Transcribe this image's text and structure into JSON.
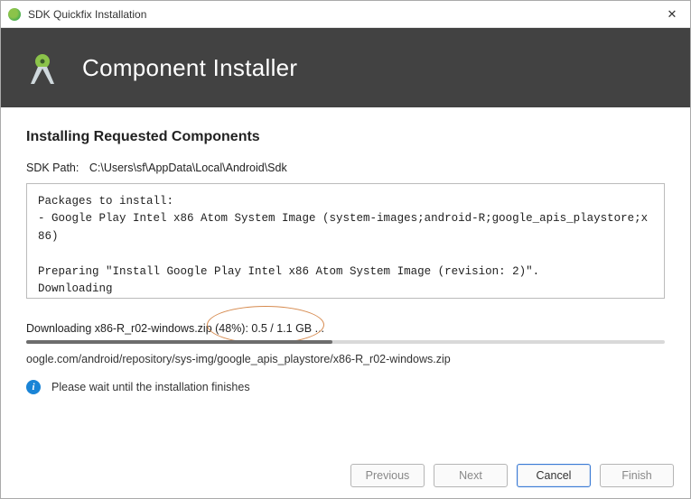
{
  "window": {
    "title": "SDK Quickfix Installation"
  },
  "banner": {
    "heading": "Component Installer"
  },
  "main": {
    "heading": "Installing Requested Components",
    "sdk_path_label": "SDK Path:",
    "sdk_path_value": "C:\\Users\\sf\\AppData\\Local\\Android\\Sdk",
    "log_text": "Packages to install:\n- Google Play Intel x86 Atom System Image (system-images;android-R;google_apis_playstore;x86)\n\nPreparing \"Install Google Play Intel x86 Atom System Image (revision: 2)\".\nDownloading\nhttps://dl.google.com/android/repository/sys-img/google_apis_playstore/x86-R_r02-windows.zip"
  },
  "progress": {
    "label": "Downloading x86-R_r02-windows.zip (48%): 0.5 / 1.1 GB ...",
    "percent": 48,
    "detail": "oogle.com/android/repository/sys-img/google_apis_playstore/x86-R_r02-windows.zip",
    "info_text": "Please wait until the installation finishes"
  },
  "buttons": {
    "previous": "Previous",
    "next": "Next",
    "cancel": "Cancel",
    "finish": "Finish"
  }
}
